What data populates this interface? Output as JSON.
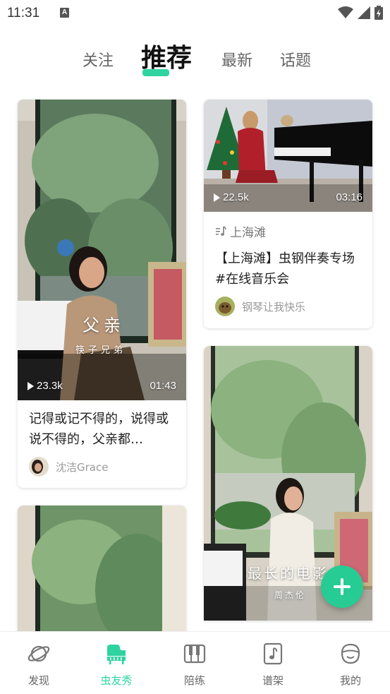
{
  "status_bar": {
    "time": "11:31",
    "notification_icon": "A"
  },
  "top_tabs": [
    {
      "label": "关注",
      "active": false
    },
    {
      "label": "推荐",
      "active": true
    },
    {
      "label": "最新",
      "active": false
    },
    {
      "label": "话题",
      "active": false
    }
  ],
  "feed": {
    "left": [
      {
        "plays": "23.3k",
        "duration": "01:43",
        "overlay_title": "父亲",
        "overlay_subtitle": "筷子兄弟",
        "title": "记得或记不得的，说得或说不得的，父亲都…",
        "author": "沈洁Grace"
      }
    ],
    "right": [
      {
        "plays": "22.5k",
        "duration": "03:16",
        "song": "上海滩",
        "title": "【上海滩】虫钢伴奏专场#在线音乐会",
        "author": "钢琴让我快乐"
      },
      {
        "overlay_title": "最长的电影",
        "overlay_subtitle": "周杰伦"
      }
    ]
  },
  "bottom_nav": [
    {
      "label": "发现",
      "icon": "planet-icon",
      "active": false
    },
    {
      "label": "虫友秀",
      "icon": "piano-icon",
      "active": true
    },
    {
      "label": "陪练",
      "icon": "keyboard-icon",
      "active": false
    },
    {
      "label": "谱架",
      "icon": "music-sheet-icon",
      "active": false
    },
    {
      "label": "我的",
      "icon": "smiley-icon",
      "active": false
    }
  ],
  "colors": {
    "accent": "#2fd3a0",
    "fab": "#26cc94"
  }
}
